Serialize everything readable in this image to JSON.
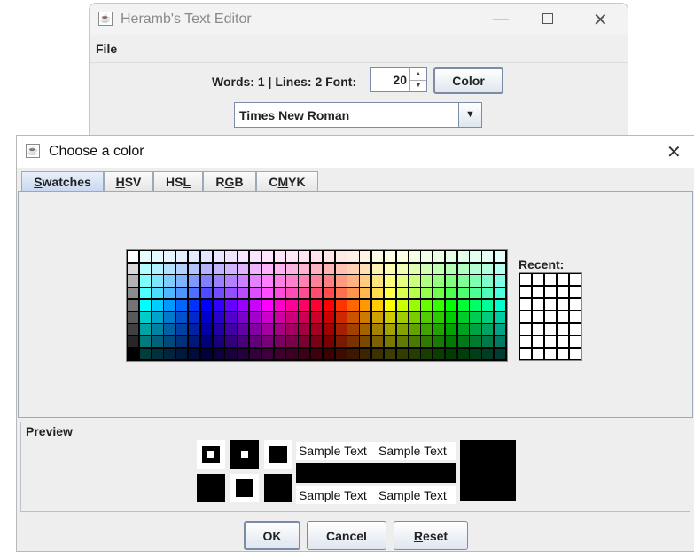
{
  "main_window": {
    "title": "Heramb's Text Editor",
    "menu": {
      "file": "File"
    },
    "toolbar": {
      "words_lines_font_label": "Words: 1 | Lines: 2 Font:",
      "font_size_value": "20",
      "color_button": "Color",
      "font_family_value": "Times New Roman"
    }
  },
  "dialog": {
    "title": "Choose a color",
    "tabs": [
      {
        "label": "Swatches",
        "mnemonic": "S",
        "active": true
      },
      {
        "label": "HSV",
        "mnemonic": "H",
        "active": false
      },
      {
        "label": "HSL",
        "mnemonic": "L",
        "active": false
      },
      {
        "label": "RGB",
        "mnemonic": "G",
        "active": false
      },
      {
        "label": "CMYK",
        "mnemonic": "M",
        "active": false
      }
    ],
    "recent_label": "Recent:",
    "preview": {
      "title": "Preview",
      "sample_text": "Sample Text",
      "color": "#000000"
    },
    "buttons": {
      "ok": "OK",
      "cancel": "Cancel",
      "reset": "Reset"
    }
  },
  "colors": {
    "swatch_border": "#000000",
    "active_tab": "#c9d9ef",
    "button_border": "#7a8ca8"
  }
}
